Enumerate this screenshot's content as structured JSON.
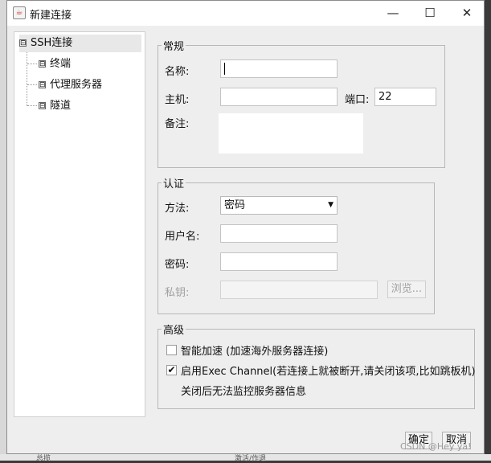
{
  "window": {
    "title": "新建连接",
    "icon": "java-cup-icon"
  },
  "titlebar_buttons": {
    "minimize": "—",
    "maximize": "☐",
    "close": "✕"
  },
  "tree": {
    "root": {
      "label": "SSH连接",
      "expander": "⊟"
    },
    "children": [
      {
        "label": "终端",
        "expander": "⊟"
      },
      {
        "label": "代理服务器",
        "expander": "⊟"
      },
      {
        "label": "隧道",
        "expander": "⊟"
      }
    ]
  },
  "general": {
    "legend": "常规",
    "name_label": "名称:",
    "name_value": "",
    "host_label": "主机:",
    "host_value": "",
    "port_label": "端口:",
    "port_value": "22",
    "note_label": "备注:",
    "note_value": ""
  },
  "auth": {
    "legend": "认证",
    "method_label": "方法:",
    "method_value": "密码",
    "method_arrow": "▼",
    "username_label": "用户名:",
    "username_value": "",
    "password_label": "密码:",
    "password_value": "",
    "key_label": "私钥:",
    "key_value": "",
    "browse_label": "浏览..."
  },
  "advanced": {
    "legend": "高级",
    "smart_accel_label": "智能加速 (加速海外服务器连接)",
    "smart_accel_checked": false,
    "exec_channel_label": "启用Exec Channel(若连接上就被断开,请关闭该项,比如跳板机)",
    "exec_channel_checked": true,
    "exec_channel_note": "关闭后无法监控服务器信息"
  },
  "footer": {
    "ok_label": "确定",
    "cancel_label": "取消"
  },
  "watermark": "CSDN @Hey ya!",
  "background": {
    "left_text": "总揽",
    "right_text": "激活/作退"
  }
}
